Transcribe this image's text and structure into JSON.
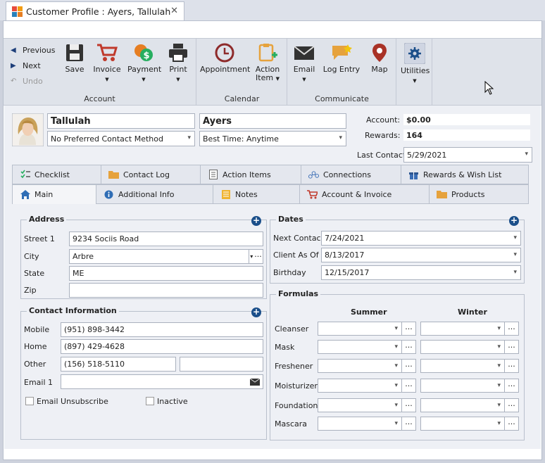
{
  "window": {
    "tab_title": "Customer Profile : Ayers, Tallulah",
    "close": "✕"
  },
  "ribbon": {
    "nav": {
      "previous": "Previous",
      "next": "Next",
      "undo": "Undo"
    },
    "account": {
      "label": "Account",
      "save": "Save",
      "invoice": "Invoice",
      "payment": "Payment",
      "print": "Print"
    },
    "calendar": {
      "label": "Calendar",
      "appointment": "Appointment",
      "action_item_1": "Action",
      "action_item_2": "Item"
    },
    "communicate": {
      "label": "Communicate",
      "email": "Email",
      "log_entry": "Log Entry",
      "map": "Map"
    },
    "utilities": {
      "label": "Utilities"
    }
  },
  "customer": {
    "first_name": "Tallulah",
    "last_name": "Ayers",
    "contact_method": "No Preferred Contact Method",
    "best_time": "Best Time: Anytime",
    "account_label": "Account:",
    "account_value": "$0.00",
    "rewards_label": "Rewards:",
    "rewards_value": "164",
    "last_contact_label": "Last Contact",
    "last_contact_value": "5/29/2021"
  },
  "tabs_row1": [
    "Checklist",
    "Contact Log",
    "Action Items",
    "Connections",
    "Rewards & Wish List"
  ],
  "tabs_row2": [
    "Main",
    "Additional Info",
    "Notes",
    "Account & Invoice",
    "Products"
  ],
  "address": {
    "title": "Address",
    "street_label": "Street 1",
    "street": "9234 Sociis Road",
    "city_label": "City",
    "city": "Arbre",
    "state_label": "State",
    "state": "ME",
    "zip_label": "Zip",
    "zip": ""
  },
  "contact": {
    "title": "Contact Information",
    "mobile_label": "Mobile",
    "mobile": "(951) 898-3442",
    "home_label": "Home",
    "home": "(897) 429-4628",
    "other_label": "Other",
    "other": "(156) 518-5110",
    "other_ext": "",
    "email_label": "Email 1",
    "email": "",
    "unsubscribe": "Email Unsubscribe",
    "inactive": "Inactive"
  },
  "dates": {
    "title": "Dates",
    "next_contact_label": "Next Contact",
    "next_contact": "7/24/2021",
    "client_as_of_label": "Client As Of",
    "client_as_of": "8/13/2017",
    "birthday_label": "Birthday",
    "birthday": "12/15/2017"
  },
  "formulas": {
    "title": "Formulas",
    "col_summer": "Summer",
    "col_winter": "Winter",
    "rows": [
      "Cleanser",
      "Mask",
      "Freshener",
      "Moisturizer",
      "Foundation",
      "Mascara"
    ]
  },
  "colors": {
    "accent": "#1b4f8a",
    "ribbon_bg": "#dfe3ea",
    "form_bg": "#eef0f5"
  }
}
